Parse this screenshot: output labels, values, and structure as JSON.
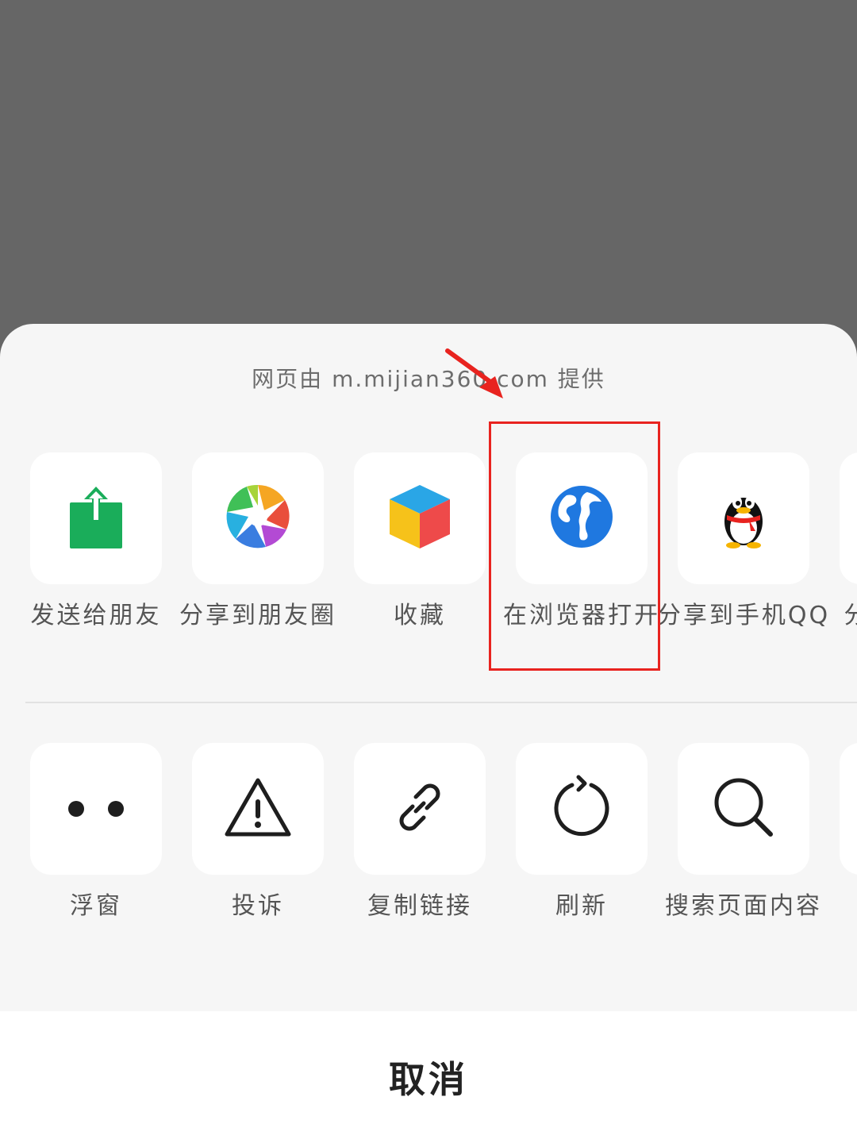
{
  "sheet": {
    "provider_text": "网页由 m.mijian360.com 提供",
    "row1": [
      {
        "icon": "share-up-icon",
        "label": "发送给朋友"
      },
      {
        "icon": "moments-aperture-icon",
        "label": "分享到朋友圈"
      },
      {
        "icon": "favorite-cube-icon",
        "label": "收藏"
      },
      {
        "icon": "globe-icon",
        "label": "在浏览器打开"
      },
      {
        "icon": "qq-penguin-icon",
        "label": "分享到手机QQ"
      },
      {
        "icon": "partial-icon",
        "label": "分"
      }
    ],
    "row2": [
      {
        "icon": "dots-icon",
        "label": "浮窗"
      },
      {
        "icon": "warning-icon",
        "label": "投诉"
      },
      {
        "icon": "link-icon",
        "label": "复制链接"
      },
      {
        "icon": "refresh-icon",
        "label": "刷新"
      },
      {
        "icon": "search-icon",
        "label": "搜索页面内容"
      },
      {
        "icon": "partial-icon",
        "label": ""
      }
    ],
    "cancel_label": "取消"
  },
  "colors": {
    "overlay": "#666666",
    "sheet_bg": "#f6f6f6",
    "highlight": "#e8231f",
    "wechat_green": "#1aad5a",
    "browser_blue": "#1f78e0"
  }
}
